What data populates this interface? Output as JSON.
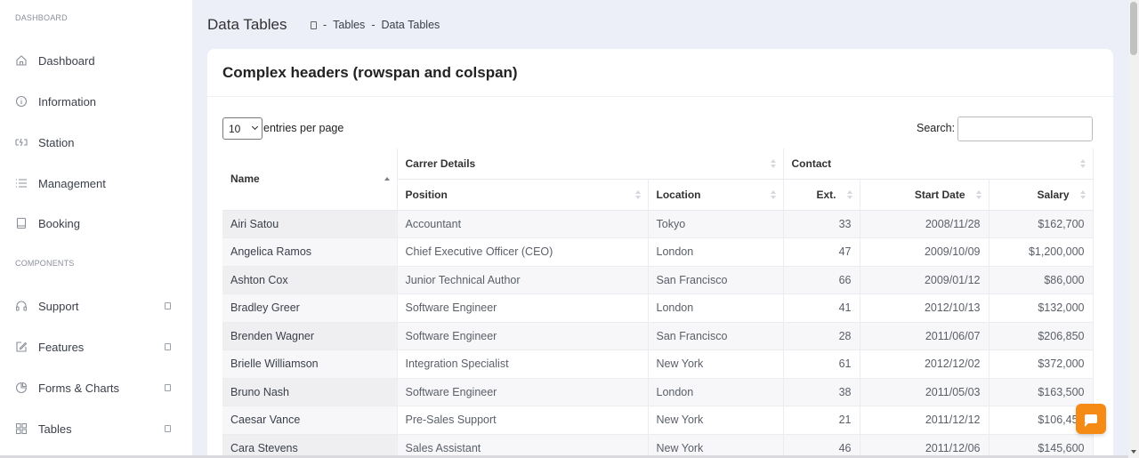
{
  "sidebar": {
    "section_dashboard": "DASHBOARD",
    "section_components": "COMPONENTS",
    "items": [
      {
        "label": "Dashboard",
        "icon": "home-icon"
      },
      {
        "label": "Information",
        "icon": "info-icon"
      },
      {
        "label": "Station",
        "icon": "charging-station-icon"
      },
      {
        "label": "Management",
        "icon": "list-icon"
      },
      {
        "label": "Booking",
        "icon": "booking-icon"
      }
    ],
    "components": [
      {
        "label": "Support",
        "icon": "headset-icon"
      },
      {
        "label": "Features",
        "icon": "edit-icon"
      },
      {
        "label": "Forms & Charts",
        "icon": "pie-chart-icon"
      },
      {
        "label": "Tables",
        "icon": "grid-icon"
      }
    ]
  },
  "header": {
    "title": "Data Tables",
    "breadcrumb": [
      "Tables",
      "Data Tables"
    ],
    "separator": "-"
  },
  "card": {
    "title": "Complex headers (rowspan and colspan)",
    "entries_value": "10",
    "entries_label": "entries per page",
    "search_label": "Search:",
    "search_value": ""
  },
  "table": {
    "group_headers": [
      "Carrer Details",
      "Contact"
    ],
    "columns": [
      "Name",
      "Position",
      "Location",
      "Ext.",
      "Start Date",
      "Salary"
    ],
    "rows": [
      [
        "Airi Satou",
        "Accountant",
        "Tokyo",
        "33",
        "2008/11/28",
        "$162,700"
      ],
      [
        "Angelica Ramos",
        "Chief Executive Officer (CEO)",
        "London",
        "47",
        "2009/10/09",
        "$1,200,000"
      ],
      [
        "Ashton Cox",
        "Junior Technical Author",
        "San Francisco",
        "66",
        "2009/01/12",
        "$86,000"
      ],
      [
        "Bradley Greer",
        "Software Engineer",
        "London",
        "41",
        "2012/10/13",
        "$132,000"
      ],
      [
        "Brenden Wagner",
        "Software Engineer",
        "San Francisco",
        "28",
        "2011/06/07",
        "$206,850"
      ],
      [
        "Brielle Williamson",
        "Integration Specialist",
        "New York",
        "61",
        "2012/12/02",
        "$372,000"
      ],
      [
        "Bruno Nash",
        "Software Engineer",
        "London",
        "38",
        "2011/05/03",
        "$163,500"
      ],
      [
        "Caesar Vance",
        "Pre-Sales Support",
        "New York",
        "21",
        "2011/12/12",
        "$106,450"
      ],
      [
        "Cara Stevens",
        "Sales Assistant",
        "New York",
        "46",
        "2011/12/06",
        "$145,600"
      ]
    ]
  },
  "colors": {
    "accent": "#f58a14",
    "page_bg": "#eceef8"
  }
}
